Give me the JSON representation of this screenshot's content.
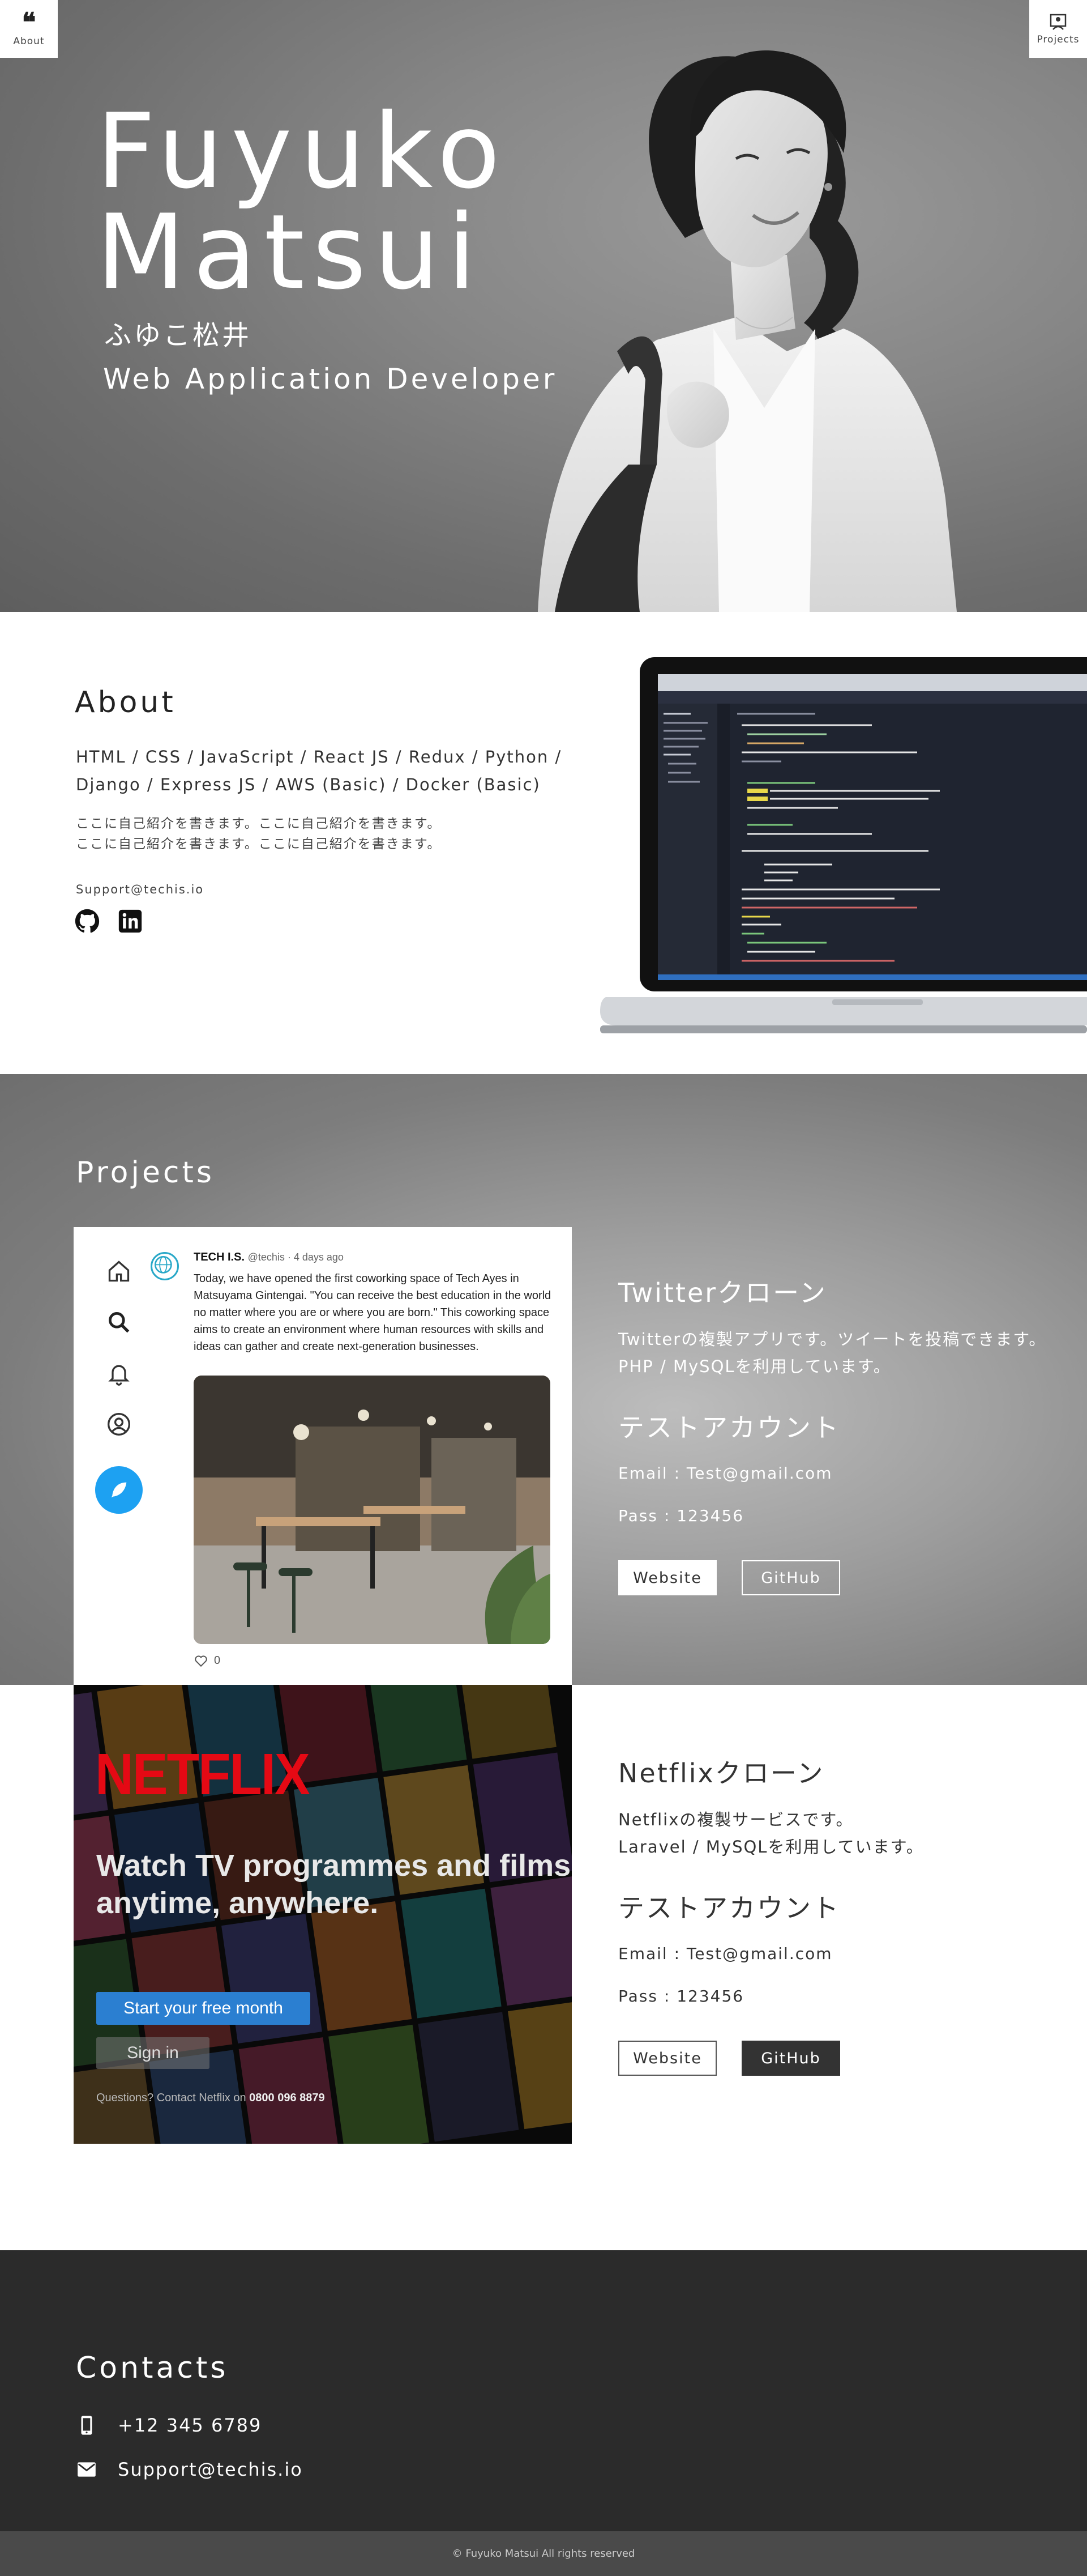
{
  "nav": {
    "about_label": "About",
    "projects_label": "Projects"
  },
  "hero": {
    "first_name": "Fuyuko",
    "last_name": "Matsui",
    "kana": "ふゆこ松井",
    "role": "Web Application Developer"
  },
  "about": {
    "title": "About",
    "skills_line1": "HTML / CSS / JavaScript / React JS / Redux / Python /",
    "skills_line2": "Django / Express JS / AWS (Basic) / Docker (Basic)",
    "intro_line1": "ここに自己紹介を書きます。ここに自己紹介を書きます。",
    "intro_line2": "ここに自己紹介を書きます。ここに自己紹介を書きます。",
    "email": "Support@techis.io",
    "social": [
      "github-icon",
      "linkedin-icon"
    ]
  },
  "projects": {
    "title": "Projects",
    "items": [
      {
        "title": "Twitterクローン",
        "desc_line1": "Twitterの複製アプリです。ツイートを投稿できます。",
        "desc_line2": "PHP / MySQLを利用しています。",
        "account_title": "テストアカウント",
        "email": "Email : Test@gmail.com",
        "pass": "Pass : 123456",
        "website_label": "Website",
        "github_label": "GitHub"
      },
      {
        "title": "Netflixクローン",
        "desc_line1": "Netflixの複製サービスです。",
        "desc_line2": "Laravel / MySQLを利用しています。",
        "account_title": "テストアカウント",
        "email": "Email : Test@gmail.com",
        "pass": "Pass : 123456",
        "website_label": "Website",
        "github_label": "GitHub"
      }
    ]
  },
  "twitter_mock": {
    "user": "TECH I.S.",
    "handle": "@techis · 4 days ago",
    "body": "Today, we have opened the first coworking space of Tech Ayes in Matsuyama Gintengai. \"You can receive the best education in the world no matter where you are or where you are born.\" This coworking space aims to create an environment where human resources with skills and ideas can gather and create next-generation businesses.",
    "likes": "0"
  },
  "netflix_mock": {
    "logo": "NETFLIX",
    "headline_line1": "Watch TV programmes and films",
    "headline_line2": "anytime, anywhere.",
    "cta": "Start your free month",
    "signin": "Sign in",
    "foot_text": "Questions? Contact Netflix on",
    "foot_phone": "0800 096 8879"
  },
  "contacts": {
    "title": "Contacts",
    "phone": "+12 345 6789",
    "email": "Support@techis.io"
  },
  "footer": {
    "copyright": "© Fuyuko Matsui All rights reserved"
  }
}
